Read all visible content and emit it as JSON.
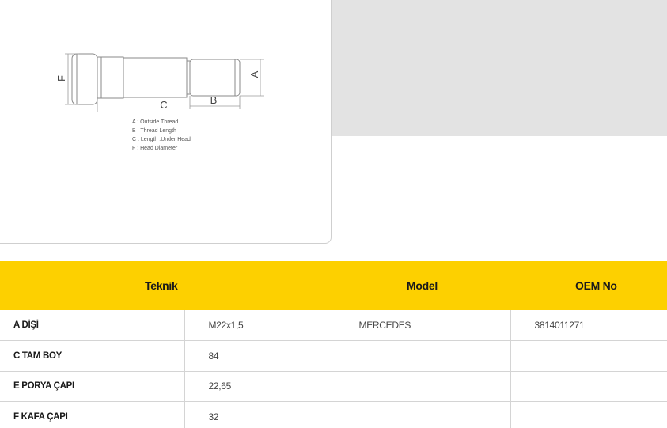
{
  "diagram": {
    "labels": {
      "a": "A",
      "b": "B",
      "c": "C",
      "f": "F"
    },
    "legend": [
      "A : Outside Thread",
      "B : Thread Length",
      "C : Length :Under Head",
      "F : Head Diameter"
    ]
  },
  "table": {
    "headers": {
      "technical": "Teknik",
      "model": "Model",
      "oem": "OEM No"
    },
    "rows": [
      {
        "label": "A DİŞİ",
        "value": "M22x1,5",
        "model": "MERCEDES",
        "oem": "3814011271"
      },
      {
        "label": "C TAM BOY",
        "value": "84",
        "model": "",
        "oem": ""
      },
      {
        "label": "E PORYA ÇAPI",
        "value": "22,65",
        "model": "",
        "oem": ""
      },
      {
        "label": "F KAFA ÇAPI",
        "value": "32",
        "model": "",
        "oem": ""
      }
    ]
  }
}
